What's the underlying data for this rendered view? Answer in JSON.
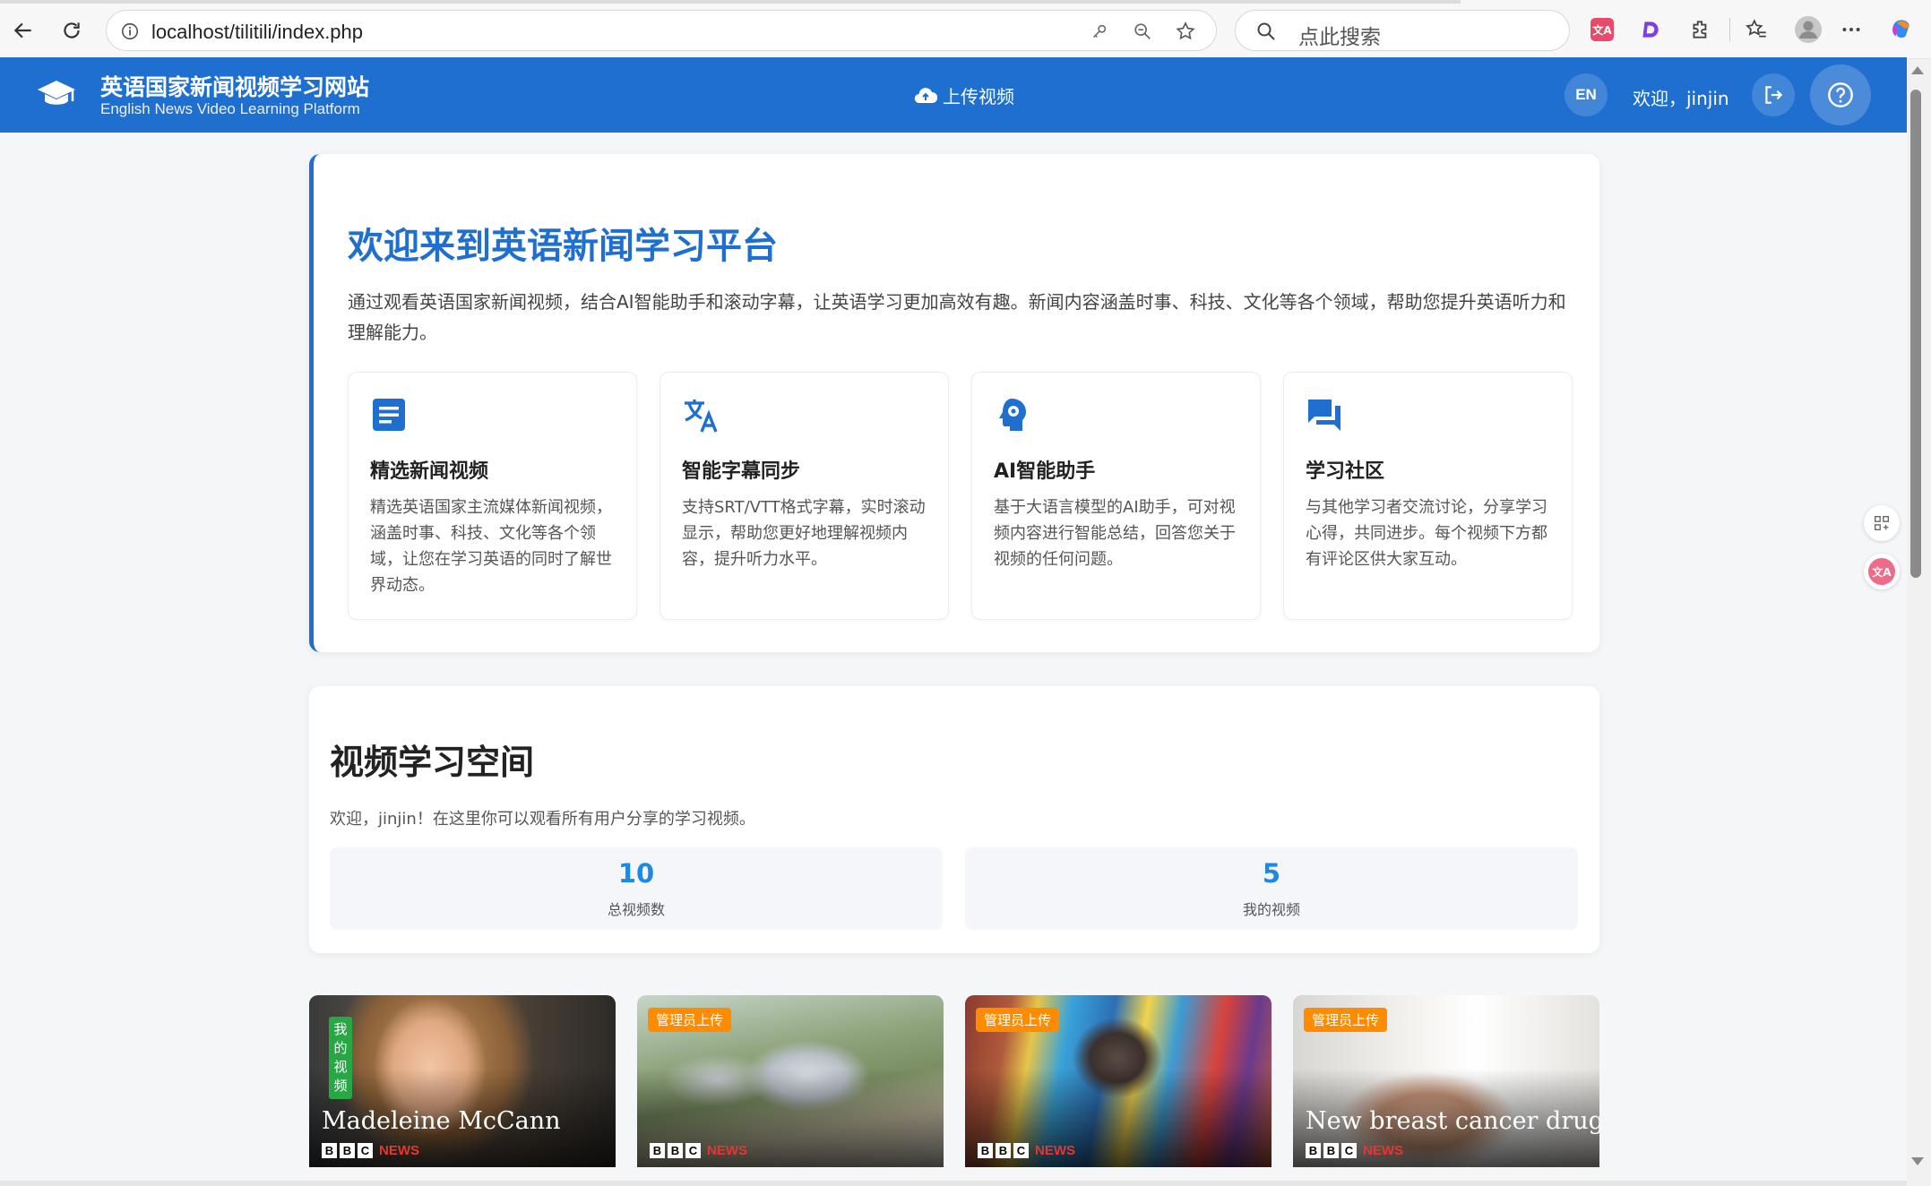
{
  "browser": {
    "url": "localhost/tilitili/index.php",
    "search_placeholder": "点此搜索"
  },
  "header": {
    "title": "英语国家新闻视频学习网站",
    "subtitle": "English News Video Learning Platform",
    "upload_label": "上传视频",
    "lang_label": "EN",
    "welcome": "欢迎，jinjin"
  },
  "intro": {
    "title": "欢迎来到英语新闻学习平台",
    "description": "通过观看英语国家新闻视频，结合AI智能助手和滚动字幕，让英语学习更加高效有趣。新闻内容涵盖时事、科技、文化等各个领域，帮助您提升英语听力和理解能力。",
    "features": [
      {
        "icon": "article-icon",
        "title": "精选新闻视频",
        "desc": "精选英语国家主流媒体新闻视频，涵盖时事、科技、文化等各个领域，让您在学习英语的同时了解世界动态。"
      },
      {
        "icon": "translate-icon",
        "title": "智能字幕同步",
        "desc": "支持SRT/VTT格式字幕，实时滚动显示，帮助您更好地理解视频内容，提升听力水平。"
      },
      {
        "icon": "ai-head-icon",
        "title": "AI智能助手",
        "desc": "基于大语言模型的AI助手，可对视频内容进行智能总结，回答您关于视频的任何问题。"
      },
      {
        "icon": "forum-icon",
        "title": "学习社区",
        "desc": "与其他学习者交流讨论，分享学习心得，共同进步。每个视频下方都有评论区供大家互动。"
      }
    ]
  },
  "space": {
    "title": "视频学习空间",
    "welcome": "欢迎，jinjin！在这里你可以观看所有用户分享的学习视频。",
    "stats": [
      {
        "value": "10",
        "label": "总视频数"
      },
      {
        "value": "5",
        "label": "我的视频"
      }
    ]
  },
  "videos": [
    {
      "title": "Madeleine McCann",
      "tag": "我的视频",
      "brand": "NEWS"
    },
    {
      "title": "",
      "tag": "管理员上传",
      "brand": "NEWS"
    },
    {
      "title": "",
      "tag": "管理员上传",
      "brand": "NEWS"
    },
    {
      "title": "New breast cancer drug",
      "tag": "管理员上传",
      "brand": "NEWS"
    }
  ],
  "colors": {
    "primary": "#1e6fd0",
    "stat_number": "#1e88e5",
    "admin_tag": "#ff8c00",
    "mine_tag": "#28a745"
  }
}
